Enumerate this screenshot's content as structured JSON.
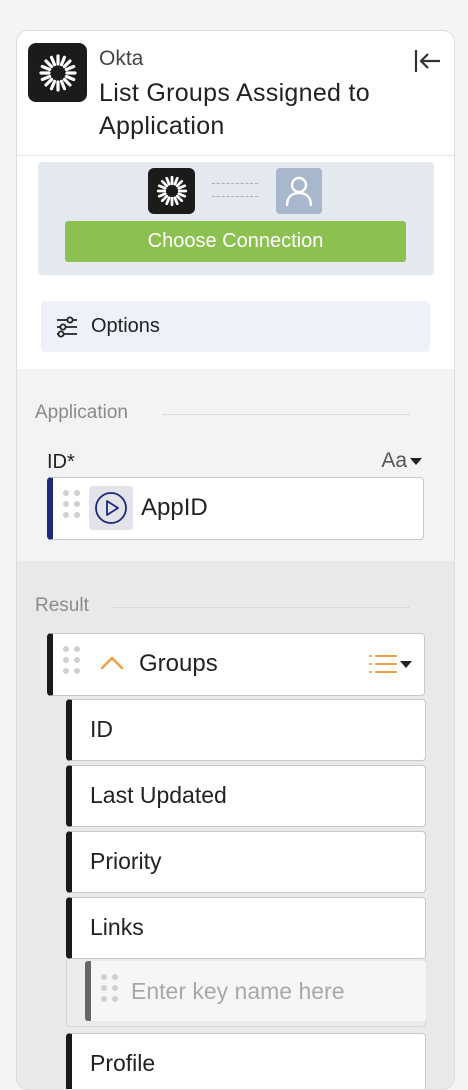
{
  "header": {
    "provider": "Okta",
    "title": "List Groups Assigned to Application",
    "logo_icon": "okta-sunburst-icon",
    "collapse_icon": "collapse-panel-icon"
  },
  "connection": {
    "button_label": "Choose Connection",
    "app_icon": "okta-sunburst-icon",
    "user_icon": "user-avatar-icon",
    "accent": "#8cc152"
  },
  "options": {
    "label": "Options",
    "icon": "sliders-icon"
  },
  "application_section": {
    "title": "Application",
    "id_label": "ID*",
    "type_toggle": "Aa",
    "field": {
      "value": "AppID",
      "icon": "play-variable-icon",
      "accent": "#1e2a78"
    }
  },
  "result_section": {
    "title": "Result",
    "groups": {
      "label": "Groups",
      "expand_icon": "chevron-up-icon",
      "list_icon": "list-icon",
      "accent": "#f0a040"
    },
    "fields": [
      "ID",
      "Last Updated",
      "Priority",
      "Links"
    ],
    "key_placeholder": "Enter key name here",
    "last_field": "Profile"
  }
}
